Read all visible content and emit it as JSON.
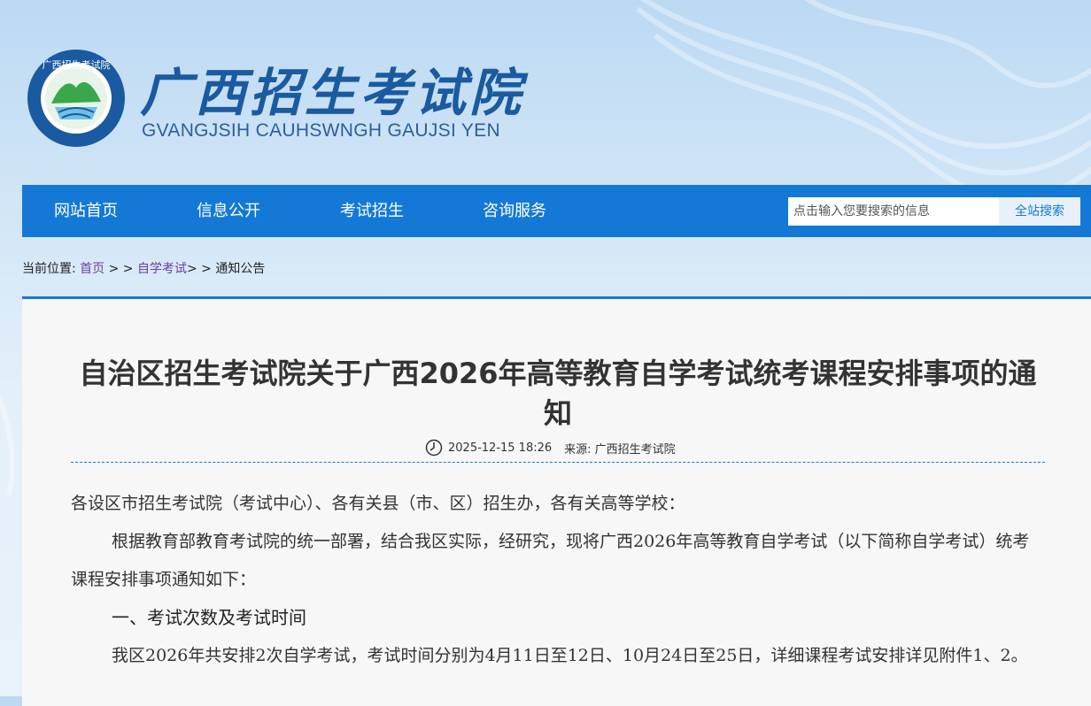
{
  "header": {
    "site_title": "广西招生考试院",
    "site_subtitle": "GVANGJSIH CAUHSWNGH GAUJSI YEN",
    "emblem_ring_text": "广西招生考试院 GVANGJSIH CAUHSWNGH GAUJSI YEN"
  },
  "nav": {
    "items": [
      "网站首页",
      "信息公开",
      "考试招生",
      "咨询服务"
    ],
    "search_placeholder": "点击输入您要搜索的信息",
    "search_button": "全站搜索"
  },
  "breadcrumb": {
    "prefix": "当前位置:",
    "home": "首页",
    "sep1": " > > ",
    "section": "自学考试",
    "sep2": "> > ",
    "current": "通知公告"
  },
  "article": {
    "title": "自治区招生考试院关于广西2026年高等教育自学考试统考课程安排事项的通知",
    "date": "2025-12-15 18:26",
    "source": "来源: 广西招生考试院",
    "salutation": "各设区市招生考试院（考试中心）、各有关县（市、区）招生办，各有关高等学校：",
    "para1": "根据教育部教育考试院的统一部署，结合我区实际，经研究，现将广西2026年高等教育自学考试（以下简称自学考试）统考课程安排事项通知如下：",
    "heading1": "一、考试次数及考试时间",
    "para2": "我区2026年共安排2次自学考试，考试时间分别为4月11日至12日、10月24日至25日，详细课程考试安排详见附件1、2。"
  },
  "colors": {
    "nav_bg": "#1479d6",
    "title_color": "#1a5aa0"
  }
}
